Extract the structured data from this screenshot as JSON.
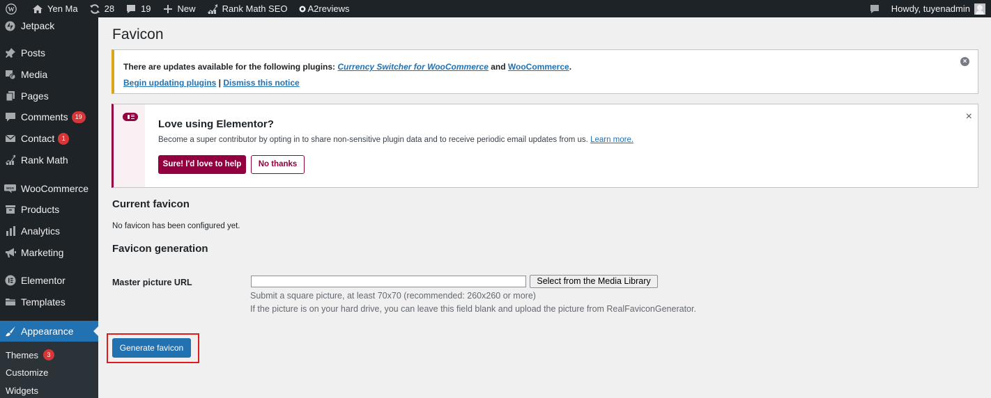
{
  "adminbar": {
    "site_name": "Yen Ma",
    "updates_count": "28",
    "comments_count": "19",
    "new_label": "New",
    "rankmath_label": "Rank Math SEO",
    "a2reviews_label": "A2reviews",
    "howdy": "Howdy, tuyenadmin"
  },
  "sidebar": {
    "items": [
      {
        "label": "Jetpack"
      },
      {
        "label": "Posts"
      },
      {
        "label": "Media"
      },
      {
        "label": "Pages"
      },
      {
        "label": "Comments",
        "badge": "19"
      },
      {
        "label": "Contact",
        "badge": "1"
      },
      {
        "label": "Rank Math"
      },
      {
        "label": "WooCommerce"
      },
      {
        "label": "Products"
      },
      {
        "label": "Analytics"
      },
      {
        "label": "Marketing"
      },
      {
        "label": "Elementor"
      },
      {
        "label": "Templates"
      },
      {
        "label": "Appearance"
      }
    ],
    "submenu": [
      {
        "label": "Themes",
        "badge": "3"
      },
      {
        "label": "Customize"
      },
      {
        "label": "Widgets"
      }
    ]
  },
  "page": {
    "title": "Favicon"
  },
  "update_notice": {
    "text_prefix": "There are updates available for the following plugins: ",
    "plugin1": "Currency Switcher for WooCommerce",
    "and": " and ",
    "plugin2": "WooCommerce",
    "period": ".",
    "begin_link": "Begin updating plugins",
    "separator": " | ",
    "dismiss_link": "Dismiss this notice"
  },
  "elementor_notice": {
    "title": "Love using Elementor?",
    "description": "Become a super contributor by opting in to share non-sensitive plugin data and to receive periodic email updates from us. ",
    "learn_more": "Learn more.",
    "primary_button": "Sure! I'd love to help",
    "secondary_button": "No thanks",
    "close": "×"
  },
  "current_favicon": {
    "heading": "Current favicon",
    "text": "No favicon has been configured yet."
  },
  "generation": {
    "heading": "Favicon generation",
    "field_label": "Master picture URL",
    "input_value": "",
    "media_button": "Select from the Media Library",
    "help1": "Submit a square picture, at least 70x70 (recommended: 260x260 or more)",
    "help2": "If the picture is on your hard drive, you can leave this field blank and upload the picture from RealFaviconGenerator.",
    "generate_button": "Generate favicon"
  },
  "colors": {
    "adminbar_bg": "#1d2327",
    "accent": "#2271b1",
    "elementor": "#93003f",
    "warning": "#dba617",
    "badge": "#d63638",
    "highlight": "#e11b1b"
  }
}
